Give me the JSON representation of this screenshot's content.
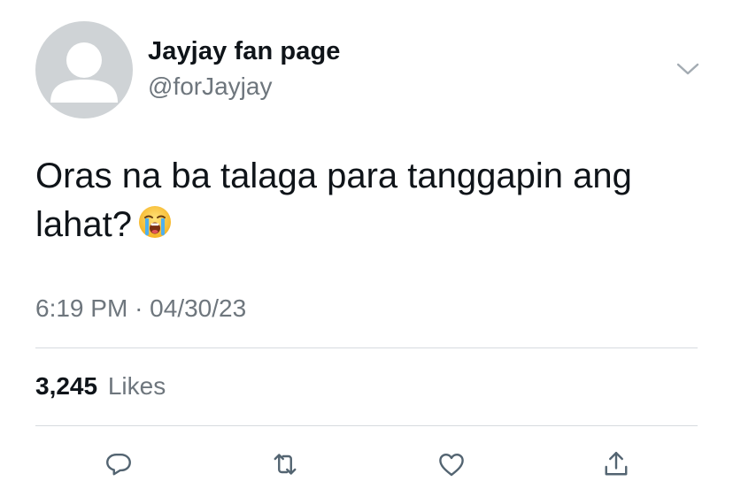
{
  "tweet": {
    "display_name": "Jayjay fan page",
    "handle": "@forJayjay",
    "text": "Oras na ba talaga para tanggapin ang lahat?",
    "emoji": "loudly-crying-face",
    "time": "6:19 PM",
    "separator": "·",
    "date": "04/30/23",
    "likes_count": "3,245",
    "likes_label": "Likes"
  },
  "icons": {
    "menu": "chevron-down-icon",
    "reply": "reply-icon",
    "retweet": "retweet-icon",
    "like": "heart-icon",
    "share": "share-icon"
  },
  "colors": {
    "text": "#0f1419",
    "secondary": "#6e767d",
    "divider": "#d7dbdf",
    "avatar_bg": "#cfd3d6"
  }
}
